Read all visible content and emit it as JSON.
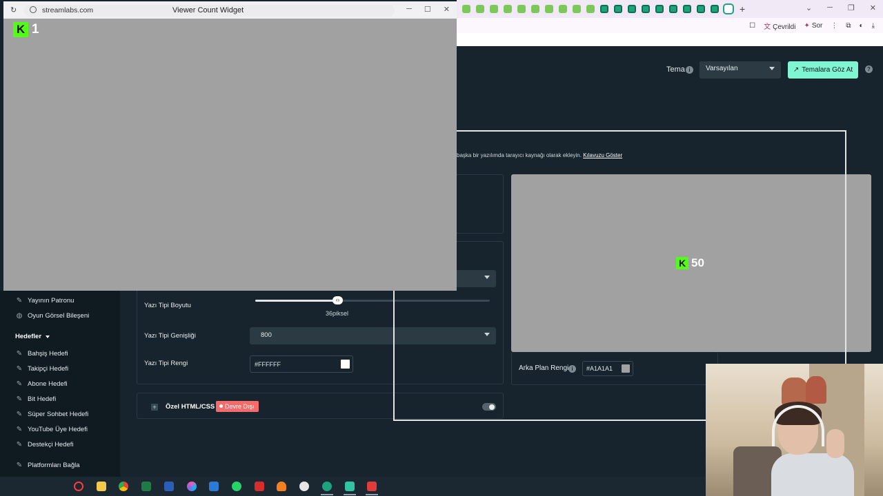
{
  "browser": {
    "toolbar": {
      "translated_label": "Çevrildi",
      "ask_label": "Sor"
    }
  },
  "header": {
    "theme_label": "Tema",
    "theme_value": "Varsayılan",
    "browse_themes_label": "Temalara Göz At"
  },
  "description": {
    "text": "başka bir yazılımda tarayıcı kaynağı olarak ekleyin.",
    "link": "Kılavuzu Göster"
  },
  "popup": {
    "url": "streamlabs.com",
    "title": "Viewer Count Widget",
    "count": "1"
  },
  "preview": {
    "count": "50",
    "bg_color_label": "Arka Plan Rengi",
    "bg_color_value": "#A1A1A1",
    "bg_color_hex": "#A1A1A1"
  },
  "sidebar": {
    "items_top": [
      {
        "label": "Yayının Patronu"
      },
      {
        "label": "Oyun Görsel Bileşeni"
      }
    ],
    "goals_header": "Hedefler",
    "goals": [
      {
        "label": "Bahşiş Hedefi"
      },
      {
        "label": "Takipçi Hedefi"
      },
      {
        "label": "Abone Hedefi"
      },
      {
        "label": "Bit Hedefi"
      },
      {
        "label": "Süper Sohbet Hedefi"
      },
      {
        "label": "YouTube Üye Hedefi"
      },
      {
        "label": "Destekçi Hedefi"
      }
    ],
    "connect_label": "Platformları Bağla"
  },
  "form": {
    "font_size_label": "Yazı Tipi Boyutu",
    "font_size_value": "36piksel",
    "font_size_fraction": 0.35,
    "font_weight_label": "Yazı Tipi Genişliği",
    "font_weight_value": "800",
    "font_color_label": "Yazı Tipi Rengi",
    "font_color_value": "#FFFFFF",
    "custom_html_label": "Özel HTML/CSS",
    "custom_html_status": "Devre Dışı"
  }
}
